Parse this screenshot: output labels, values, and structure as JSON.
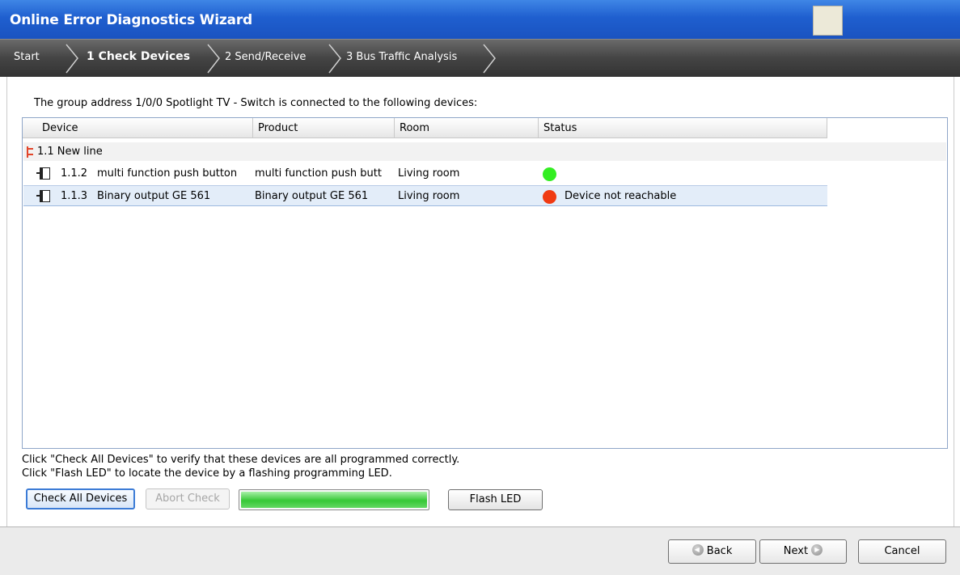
{
  "window": {
    "title": "Online Error Diagnostics Wizard"
  },
  "steps": [
    {
      "label": "Start"
    },
    {
      "label": "1 Check Devices"
    },
    {
      "label": "2 Send/Receive"
    },
    {
      "label": "3 Bus Traffic Analysis"
    }
  ],
  "intro": "The group address 1/0/0 Spotlight TV - Switch is connected to the following devices:",
  "table": {
    "columns": [
      "Device",
      "Product",
      "Room",
      "Status"
    ],
    "group": {
      "label": "1.1 New line"
    },
    "rows": [
      {
        "address": "1.1.2",
        "device": "multi function push button",
        "product": "multi function push butt",
        "room": "Living room",
        "status_text": "",
        "status_color": "#33ee22"
      },
      {
        "address": "1.1.3",
        "device": "Binary output GE 561",
        "product": "Binary output GE 561",
        "room": "Living room",
        "status_text": "Device not reachable",
        "status_color": "#f03a12"
      }
    ]
  },
  "help": {
    "line1": "Click \"Check All Devices\" to verify that these devices are all programmed correctly.",
    "line2": "Click \"Flash LED\" to locate the device by a flashing programming LED."
  },
  "buttons": {
    "check_all": "Check All Devices",
    "abort": "Abort Check",
    "flash": "Flash LED",
    "back": "Back",
    "next": "Next",
    "cancel": "Cancel"
  },
  "progress": {
    "value": 1.0
  }
}
